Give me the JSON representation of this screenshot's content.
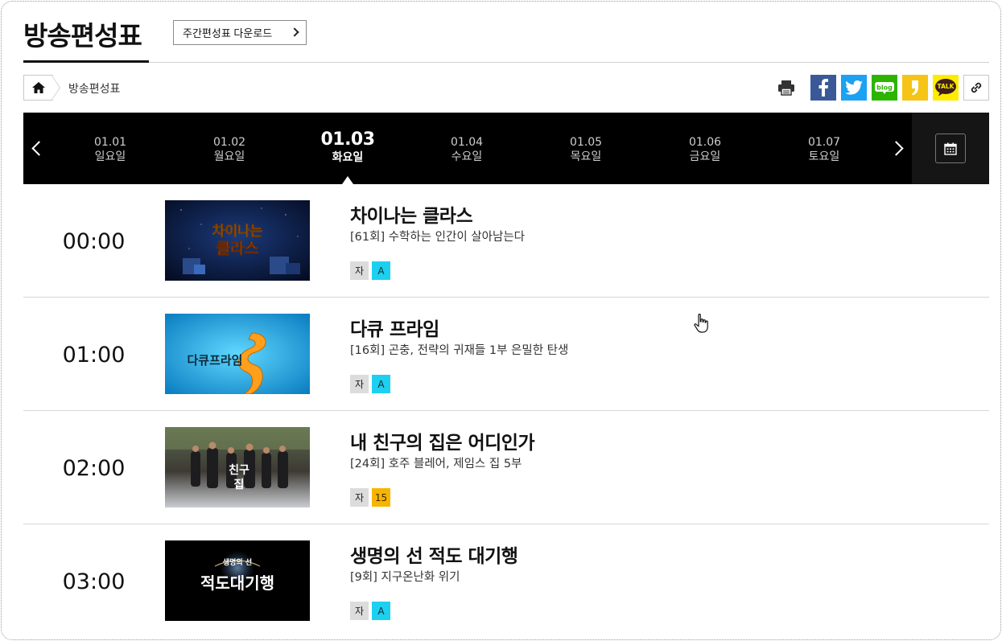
{
  "header": {
    "title": "방송편성표",
    "weekly_download_label": "주간편성표 다운로드"
  },
  "breadcrumb": {
    "current": "방송편성표"
  },
  "share": {
    "icons": [
      "print-icon",
      "facebook-icon",
      "twitter-icon",
      "blog-icon",
      "kakaostory-icon",
      "kakaotalk-icon",
      "link-icon"
    ],
    "blog_label": "blog",
    "talk_label": "TALK",
    "colors": {
      "facebook": "#3b5998",
      "twitter": "#1da1f2",
      "blog": "#2db400",
      "kakaostory": "#f5c416",
      "kakaotalk": "#ffeb00"
    }
  },
  "dates": {
    "days": [
      {
        "date": "01.01",
        "weekday": "일요일"
      },
      {
        "date": "01.02",
        "weekday": "월요일"
      },
      {
        "date": "01.03",
        "weekday": "화요일"
      },
      {
        "date": "01.04",
        "weekday": "수요일"
      },
      {
        "date": "01.05",
        "weekday": "목요일"
      },
      {
        "date": "01.06",
        "weekday": "금요일"
      },
      {
        "date": "01.07",
        "weekday": "토요일"
      }
    ],
    "active_index": 2
  },
  "programs": [
    {
      "time": "00:00",
      "title": "차이나는 클라스",
      "episode": "[61회] 수학하는 인간이 살아남는다",
      "badges": [
        {
          "label": "자",
          "type": "subtitle"
        },
        {
          "label": "A",
          "type": "all"
        }
      ],
      "thumb_text": [
        "차이나는",
        "클라스"
      ]
    },
    {
      "time": "01:00",
      "title": "다큐 프라임",
      "episode": "[16회] 곤충, 전략의 귀재들 1부 은밀한 탄생",
      "badges": [
        {
          "label": "자",
          "type": "subtitle"
        },
        {
          "label": "A",
          "type": "all"
        }
      ],
      "thumb_text": [
        "다큐프라임"
      ]
    },
    {
      "time": "02:00",
      "title": "내 친구의 집은 어디인가",
      "episode": "[24회] 호주 블레어, 제임스 집 5부",
      "badges": [
        {
          "label": "자",
          "type": "subtitle"
        },
        {
          "label": "15",
          "type": "age15"
        }
      ],
      "thumb_text": [
        "친구",
        "집"
      ]
    },
    {
      "time": "03:00",
      "title": "생명의 선 적도 대기행",
      "episode": "[9회] 지구온난화 위기",
      "badges": [
        {
          "label": "자",
          "type": "subtitle"
        },
        {
          "label": "A",
          "type": "all"
        }
      ],
      "thumb_text": [
        "생명의 선",
        "적도대기행"
      ]
    }
  ]
}
